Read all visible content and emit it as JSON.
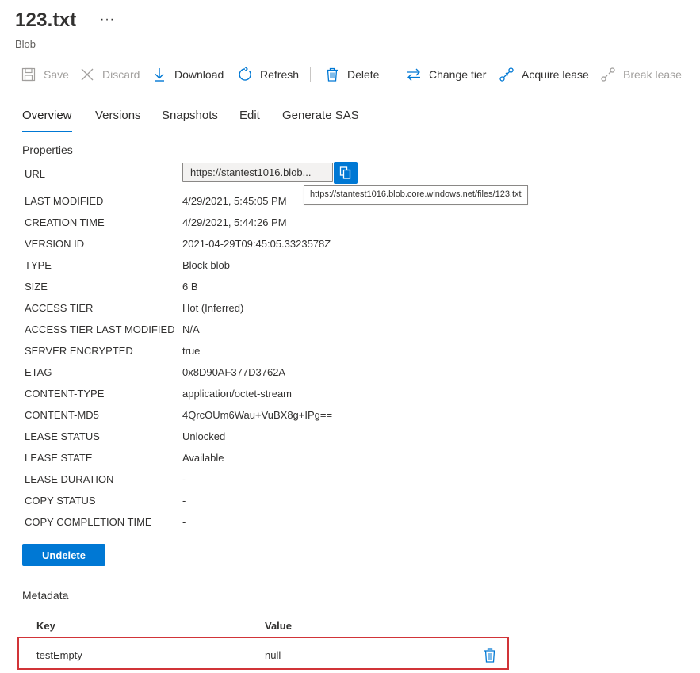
{
  "header": {
    "title": "123.txt",
    "more": "···",
    "subtitle": "Blob"
  },
  "toolbar": {
    "save": "Save",
    "discard": "Discard",
    "download": "Download",
    "refresh": "Refresh",
    "delete": "Delete",
    "change_tier": "Change tier",
    "acquire_lease": "Acquire lease",
    "break_lease": "Break lease"
  },
  "tabs": {
    "overview": "Overview",
    "versions": "Versions",
    "snapshots": "Snapshots",
    "edit": "Edit",
    "generate_sas": "Generate SAS"
  },
  "properties": {
    "title": "Properties",
    "url_label": "URL",
    "url_value": "https://stantest1016.blob...",
    "url_tooltip": "https://stantest1016.blob.core.windows.net/files/123.txt",
    "rows": [
      {
        "label": "LAST MODIFIED",
        "value": "4/29/2021, 5:45:05 PM"
      },
      {
        "label": "CREATION TIME",
        "value": "4/29/2021, 5:44:26 PM"
      },
      {
        "label": "VERSION ID",
        "value": "2021-04-29T09:45:05.3323578Z"
      },
      {
        "label": "TYPE",
        "value": "Block blob"
      },
      {
        "label": "SIZE",
        "value": "6 B"
      },
      {
        "label": "ACCESS TIER",
        "value": "Hot (Inferred)"
      },
      {
        "label": "ACCESS TIER LAST MODIFIED",
        "value": "N/A"
      },
      {
        "label": "SERVER ENCRYPTED",
        "value": "true"
      },
      {
        "label": "ETAG",
        "value": "0x8D90AF377D3762A"
      },
      {
        "label": "CONTENT-TYPE",
        "value": "application/octet-stream"
      },
      {
        "label": "CONTENT-MD5",
        "value": "4QrcOUm6Wau+VuBX8g+IPg=="
      },
      {
        "label": "LEASE STATUS",
        "value": "Unlocked"
      },
      {
        "label": "LEASE STATE",
        "value": "Available"
      },
      {
        "label": "LEASE DURATION",
        "value": "-"
      },
      {
        "label": "COPY STATUS",
        "value": "-"
      },
      {
        "label": "COPY COMPLETION TIME",
        "value": "-"
      }
    ]
  },
  "undelete_label": "Undelete",
  "metadata": {
    "title": "Metadata",
    "key_header": "Key",
    "value_header": "Value",
    "rows": [
      {
        "key": "testEmpty",
        "value": "null"
      }
    ]
  },
  "colors": {
    "accent": "#0078d4",
    "highlight_border": "#d13438"
  }
}
